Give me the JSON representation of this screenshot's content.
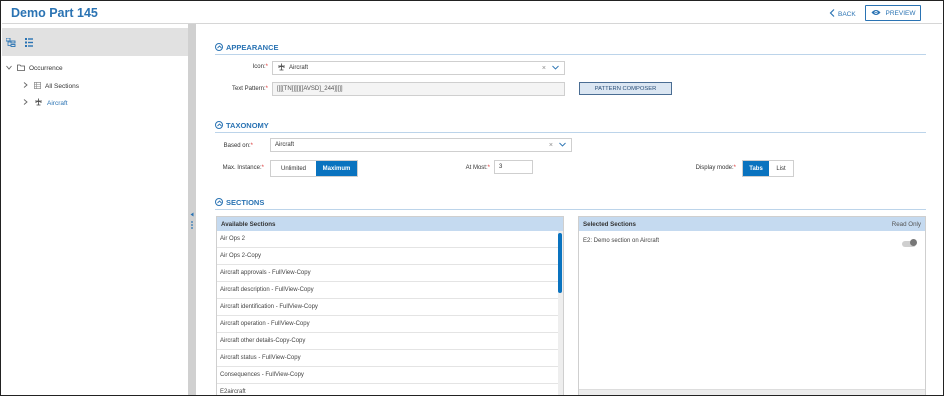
{
  "header": {
    "title": "Demo Part 145",
    "back_label": "BACK",
    "preview_label": "PREVIEW"
  },
  "tree": {
    "root": "Occurrence",
    "children": [
      "All Sections",
      "Aircraft"
    ]
  },
  "appearance": {
    "heading": "APPEARANCE",
    "icon_label": "Icon:",
    "icon_value": "Aircraft",
    "pattern_label": "Text Pattern:",
    "pattern_value": "[[[[TN]]]]][[AVSD]_244]][]]",
    "compose_button": "PATTERN COMPOSER"
  },
  "taxonomy": {
    "heading": "TAXONOMY",
    "based_on_label": "Based on:",
    "based_on_value": "Aircraft",
    "max_instance_label": "Max. Instance:",
    "max_options": [
      "Unlimited",
      "Maximum"
    ],
    "max_selected": "Maximum",
    "at_most_label": "At Most:",
    "at_most_value": "3",
    "display_mode_label": "Display mode:",
    "display_options": [
      "Tabs",
      "List"
    ],
    "display_selected": "Tabs"
  },
  "sections": {
    "heading": "SECTIONS",
    "available_header": "Available Sections",
    "available": [
      "Air Ops 2",
      "Air Ops 2-Copy",
      "Aircraft approvals - FullView-Copy",
      "Aircraft description - FullView-Copy",
      "Aircraft identification - FullView-Copy",
      "Aircraft operation - FullView-Copy",
      "Aircraft other details-Copy-Copy",
      "Aircraft status - FullView-Copy",
      "Consequences - FullView-Copy",
      "E2aircraft"
    ],
    "selected_header": "Selected Sections",
    "read_only_label": "Read Only",
    "selected": [
      "E2: Demo section on Aircraft"
    ]
  },
  "colors": {
    "accent": "#2a73b3",
    "active": "#0a73bf",
    "panel_header": "#c5daf0"
  }
}
